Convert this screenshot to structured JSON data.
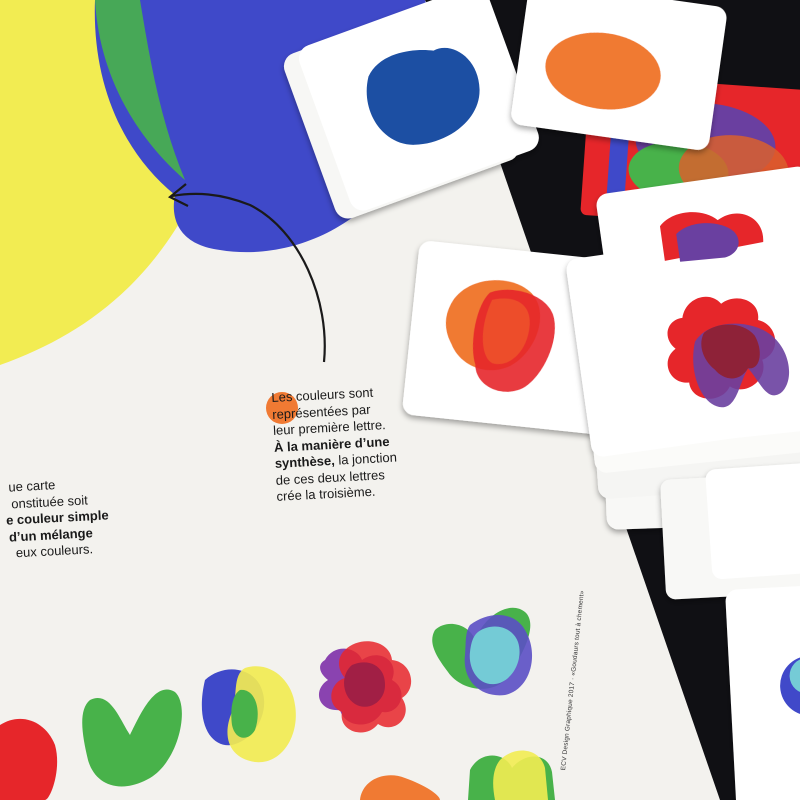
{
  "colors": {
    "background": "#101014",
    "poster": "#f3f2ee",
    "yellow": "#f2ec52",
    "green": "#48b24a",
    "blue": "#3f49c9",
    "orange": "#f07a33",
    "red": "#e6262a",
    "purple": "#6a3fa0",
    "navy": "#1d4fa3",
    "card": "#ffffff",
    "text": "#1a1a1a"
  },
  "poster": {
    "right_text": {
      "line1": "Les couleurs sont",
      "line2": "représentées par",
      "line3": "leur première lettre.",
      "line4_bold": "À la manière d’une",
      "line5_bold": "synthèse,",
      "line5_rest": " la jonction",
      "line6": "de ces deux lettres",
      "line7": "crée la troisième."
    },
    "left_text": {
      "line1": "ue carte",
      "line2": "onstituée soit",
      "line3_bold": "e couleur simple",
      "line4_bold": "d’un mélange",
      "line5": "eux couleurs."
    },
    "spine_text": "ECV Design Graphique 2017 · «Goudaurs tout à chement»"
  }
}
